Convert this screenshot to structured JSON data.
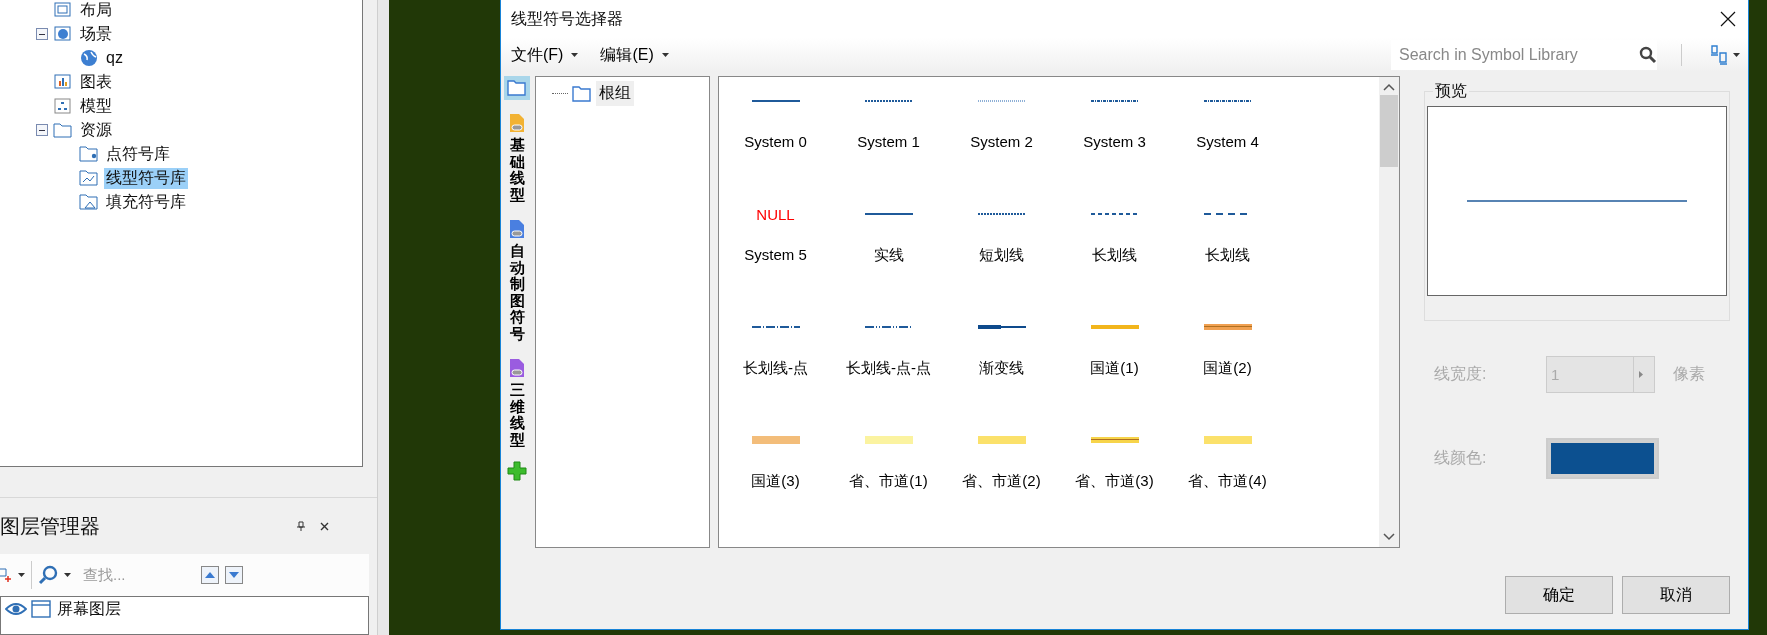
{
  "workspace_tree": {
    "items": [
      {
        "label": "布局",
        "kind": "layout",
        "selected": false
      },
      {
        "label": "场景",
        "kind": "scene",
        "expanded": true,
        "selected": false,
        "children": [
          {
            "label": "qz",
            "kind": "globe",
            "selected": false
          }
        ]
      },
      {
        "label": "图表",
        "kind": "chart",
        "selected": false
      },
      {
        "label": "模型",
        "kind": "model",
        "selected": false
      },
      {
        "label": "资源",
        "kind": "folder",
        "expanded": true,
        "selected": false,
        "children": [
          {
            "label": "点符号库",
            "kind": "point-lib",
            "selected": false
          },
          {
            "label": "线型符号库",
            "kind": "line-lib",
            "selected": true
          },
          {
            "label": "填充符号库",
            "kind": "fill-lib",
            "selected": false
          }
        ]
      }
    ]
  },
  "layer_manager": {
    "title": "图层管理器",
    "search": {
      "placeholder": "查找..."
    },
    "layers": [
      {
        "label": "屏幕图层",
        "visible": true
      }
    ]
  },
  "dialog": {
    "title": "线型符号选择器",
    "menu": [
      {
        "label": "文件(F)"
      },
      {
        "label": "编辑(E)"
      }
    ],
    "search": {
      "placeholder": "Search in Symbol Library"
    },
    "side_tabs": [
      {
        "kind": "folder",
        "selected": true
      },
      {
        "kind": "group",
        "label": "基础线型",
        "color": "#f2b233",
        "selected": false
      },
      {
        "kind": "group",
        "label": "自动制图符号",
        "color": "#4a7fe0",
        "selected": false
      },
      {
        "kind": "group",
        "label": "三维线型",
        "color": "#9a5ce0",
        "selected": false
      }
    ],
    "group_tree": [
      {
        "label": "根组",
        "selected": true
      }
    ],
    "symbols": [
      {
        "label": "System 0",
        "kind": "solid",
        "color": "#1f5a9a"
      },
      {
        "label": "System 1",
        "kind": "dashfine",
        "color": "#1f5a9a"
      },
      {
        "label": "System 2",
        "kind": "dotfine",
        "color": "#8fb0d6"
      },
      {
        "label": "System 3",
        "kind": "dashdotfine",
        "color": "#1f5a9a"
      },
      {
        "label": "System 4",
        "kind": "dashdotfine",
        "color": "#1f5a9a"
      },
      {
        "label": "System 5",
        "kind": "null",
        "text": "NULL"
      },
      {
        "label": "实线",
        "kind": "solid",
        "color": "#1f5a9a"
      },
      {
        "label": "短划线",
        "kind": "dashfine",
        "color": "#1f5a9a"
      },
      {
        "label": "长划线",
        "kind": "dash",
        "color": "#1f5a9a"
      },
      {
        "label": "长划线",
        "kind": "longdash",
        "color": "#1f5a9a"
      },
      {
        "label": "长划线-点",
        "kind": "longdashdot",
        "color": "#1f5a9a"
      },
      {
        "label": "长划线-点-点",
        "kind": "longdashdotdot",
        "color": "#1f5a9a"
      },
      {
        "label": "渐变线",
        "kind": "taper",
        "color": "#0e4a8c"
      },
      {
        "label": "国道(1)",
        "kind": "thinband",
        "color": "#f2b51c"
      },
      {
        "label": "国道(2)",
        "kind": "doubleband",
        "color": "#f0a050"
      },
      {
        "label": "国道(3)",
        "kind": "band",
        "color": "#f3bd7a"
      },
      {
        "label": "省、市道(1)",
        "kind": "band",
        "color": "#fbf3a0"
      },
      {
        "label": "省、市道(2)",
        "kind": "band",
        "color": "#fbe16b"
      },
      {
        "label": "省、市道(3)",
        "kind": "doubleband",
        "color": "#f7d44a"
      },
      {
        "label": "省、市道(4)",
        "kind": "band",
        "color": "#fbe16b"
      }
    ],
    "preview": {
      "title": "预览"
    },
    "line_width": {
      "label": "线宽度:",
      "value": "1",
      "unit": "像素",
      "disabled": true
    },
    "line_color": {
      "label": "线颜色:",
      "color": "#0c5090",
      "disabled": true
    },
    "buttons": [
      {
        "label": "确定"
      },
      {
        "label": "取消"
      }
    ]
  }
}
